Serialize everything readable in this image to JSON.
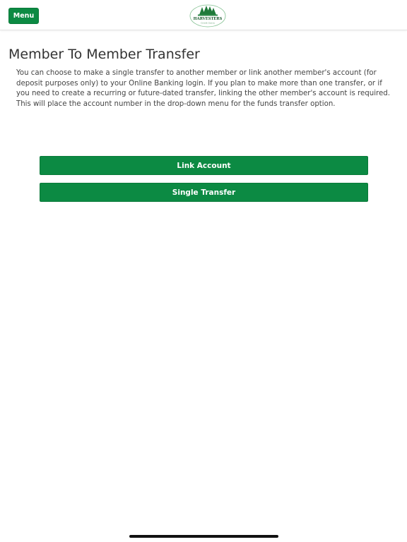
{
  "header": {
    "menu_label": "Menu",
    "logo": {
      "icon": "harvesters-tree-logo",
      "brand_text": "HARVESTERS",
      "tagline": "Credit Union"
    }
  },
  "main": {
    "title": "Member To Member Transfer",
    "description": "You can choose to make a single transfer to another member or link another member's account (for deposit purposes only) to your Online Banking login. If you plan to make more than one transfer, or if you need to create a recurring or future-dated transfer, linking the other member's account is required. This will place the account number in the drop-down menu for the funds transfer option.",
    "buttons": {
      "link_account": "Link Account",
      "single_transfer": "Single Transfer"
    }
  },
  "colors": {
    "brand_green": "#0c8a43",
    "text_dark": "#333333"
  }
}
